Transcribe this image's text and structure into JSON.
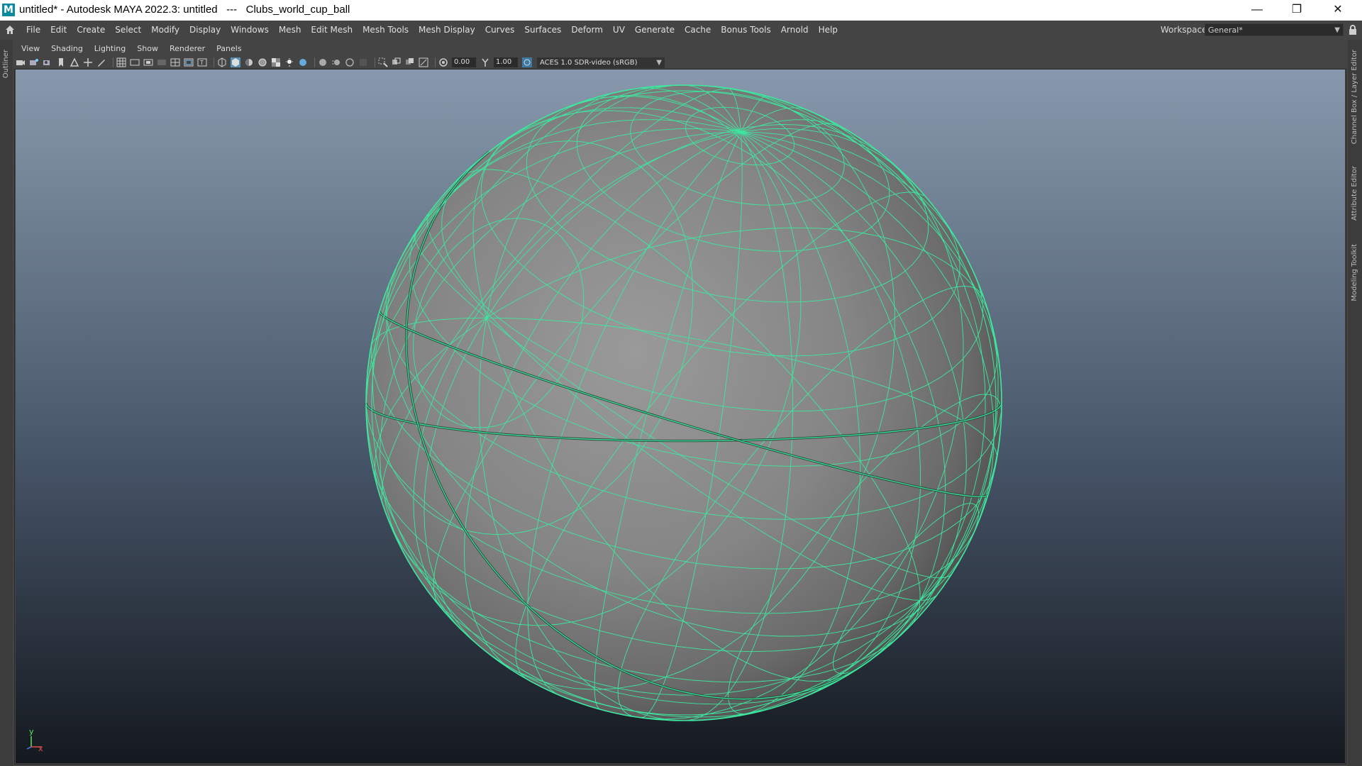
{
  "titlebar": {
    "title": "untitled* - Autodesk MAYA 2022.3: untitled   ---   Clubs_world_cup_ball",
    "logo_letter": "M",
    "minimize_glyph": "—",
    "restore_glyph": "❐",
    "close_glyph": "✕"
  },
  "menubar": {
    "items": [
      "File",
      "Edit",
      "Create",
      "Select",
      "Modify",
      "Display",
      "Windows",
      "Mesh",
      "Edit Mesh",
      "Mesh Tools",
      "Mesh Display",
      "Curves",
      "Surfaces",
      "Deform",
      "UV",
      "Generate",
      "Cache",
      "Bonus Tools",
      "Arnold",
      "Help"
    ],
    "workspace_label": "Workspace:",
    "workspace_value": "General*"
  },
  "side_tabs": {
    "left": "Outliner",
    "right": [
      "Channel Box / Layer Editor",
      "Attribute Editor",
      "Modeling Toolkit"
    ]
  },
  "panel": {
    "menu": [
      "View",
      "Shading",
      "Lighting",
      "Show",
      "Renderer",
      "Panels"
    ],
    "exposure": "0.00",
    "gamma": "1.00",
    "colorspace": "ACES 1.0 SDR-video (sRGB)"
  },
  "viewport": {
    "axis_y": "y",
    "axis_x": "x",
    "wire_color": "#3ce8a0",
    "mesh_color": "#8c8c8c"
  },
  "colors": {
    "ui_bg": "#444444",
    "viewport_top": "#8899ad",
    "viewport_bottom": "#15191f"
  }
}
